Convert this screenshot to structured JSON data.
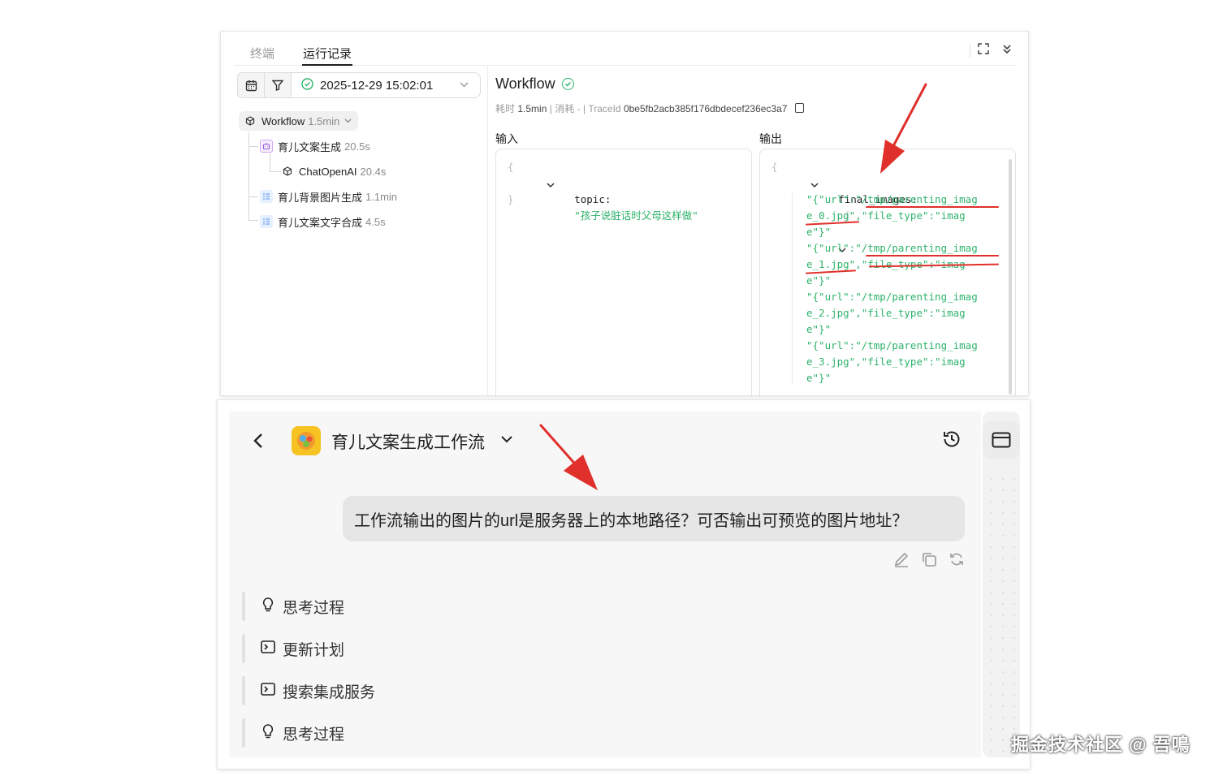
{
  "top_panel": {
    "tabs": [
      {
        "label": "终端",
        "active": false
      },
      {
        "label": "运行记录",
        "active": true
      }
    ],
    "icons": {
      "fullscreen": "fullscreen-icon",
      "collapse": "double-chevron-down-icon"
    },
    "run_selector": {
      "value": "2025-12-29 15:02:01",
      "status": "success"
    },
    "tree": {
      "root": {
        "name": "Workflow",
        "duration": "1.5min"
      },
      "children": [
        {
          "name": "育儿文案生成",
          "duration": "20.5s",
          "icon": "robot-icon",
          "children": [
            {
              "name": "ChatOpenAI",
              "duration": "20.4s",
              "icon": "cube-icon"
            }
          ]
        },
        {
          "name": "育儿背景图片生成",
          "duration": "1.1min",
          "icon": "list-icon"
        },
        {
          "name": "育儿文案文字合成",
          "duration": "4.5s",
          "icon": "list-icon"
        }
      ]
    },
    "detail": {
      "title": "Workflow",
      "meta_time_label": "耗时",
      "meta_time": "1.5min",
      "meta_cost_label": "消耗",
      "meta_cost": "-",
      "meta_trace_label": "TraceId",
      "meta_trace": "0be5fb2acb385f176dbdecef236ec3a7",
      "input_label": "输入",
      "output_label": "输出",
      "input": {
        "key": "topic:",
        "value": "\"孩子说脏话时父母这样做\""
      },
      "output": {
        "key": "final_images:",
        "lines": [
          "\"{\"url\":\"/tmp/parenting_imag",
          "e_0.jpg\",\"file_type\":\"imag",
          "e\"}\"",
          "\"{\"url\":\"/tmp/parenting_imag",
          "e_1.jpg\",\"file_type\":\"imag",
          "e\"}\"",
          "\"{\"url\":\"/tmp/parenting_imag",
          "e_2.jpg\",\"file_type\":\"imag",
          "e\"}\"",
          "\"{\"url\":\"/tmp/parenting_imag",
          "e_3.jpg\",\"file_type\":\"imag",
          "e\"}\""
        ]
      }
    }
  },
  "bottom_panel": {
    "app_title": "育儿文案生成工作流",
    "user_message": "工作流输出的图片的url是服务器上的本地路径？可否输出可预览的图片地址？",
    "message_actions": [
      "edit-icon",
      "copy-icon",
      "regenerate-icon"
    ],
    "steps": [
      {
        "label": "思考过程",
        "icon": "lightbulb-icon"
      },
      {
        "label": "更新计划",
        "icon": "terminal-icon"
      },
      {
        "label": "搜索集成服务",
        "icon": "terminal-icon"
      },
      {
        "label": "思考过程",
        "icon": "lightbulb-icon"
      }
    ]
  },
  "watermark": "掘金技术社区 @ 吾鳴",
  "colors": {
    "success": "#2fb36b",
    "annotation_red": "#e0302b",
    "json_string": "#2fb36b"
  }
}
